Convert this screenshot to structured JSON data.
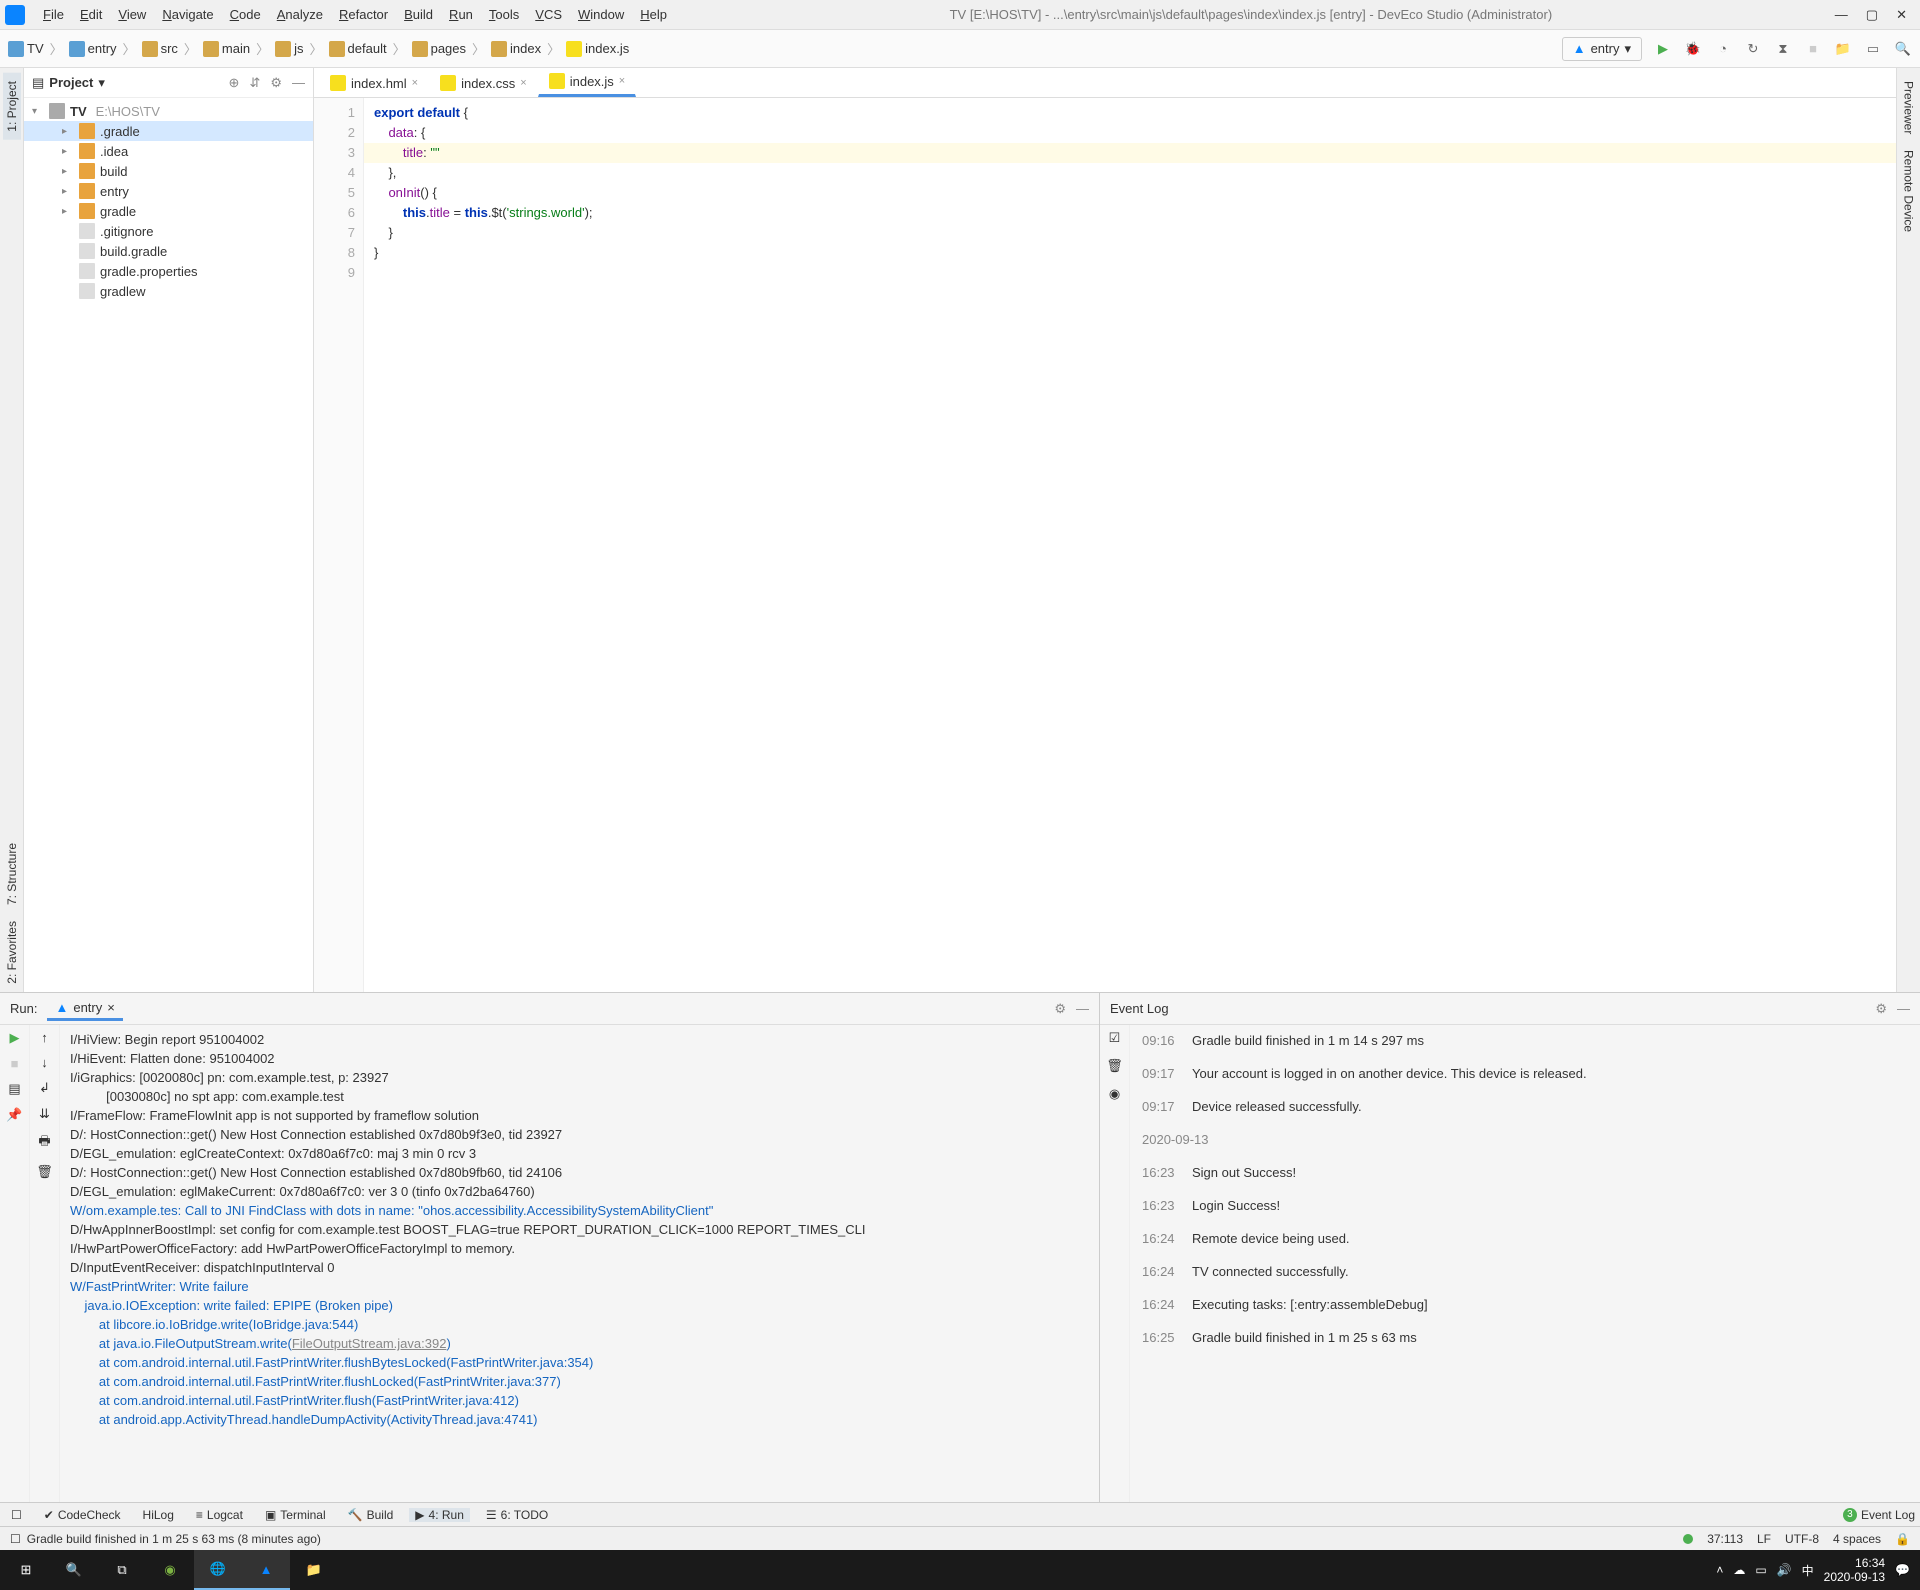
{
  "menubar": {
    "items": [
      "File",
      "Edit",
      "View",
      "Navigate",
      "Code",
      "Analyze",
      "Refactor",
      "Build",
      "Run",
      "Tools",
      "VCS",
      "Window",
      "Help"
    ],
    "title": "TV [E:\\HOS\\TV] - ...\\entry\\src\\main\\js\\default\\pages\\index\\index.js [entry] - DevEco Studio (Administrator)"
  },
  "breadcrumbs": [
    "TV",
    "entry",
    "src",
    "main",
    "js",
    "default",
    "pages",
    "index",
    "index.js"
  ],
  "run_config": "entry",
  "project": {
    "header": "Project",
    "root_label": "TV",
    "root_path": "E:\\HOS\\TV",
    "items": [
      {
        "label": ".gradle",
        "type": "folder",
        "depth": 1,
        "expandable": true,
        "selected": true
      },
      {
        "label": ".idea",
        "type": "folder",
        "depth": 1,
        "expandable": true
      },
      {
        "label": "build",
        "type": "folder",
        "depth": 1,
        "expandable": true
      },
      {
        "label": "entry",
        "type": "folder",
        "depth": 1,
        "expandable": true
      },
      {
        "label": "gradle",
        "type": "folder",
        "depth": 1,
        "expandable": true
      },
      {
        "label": ".gitignore",
        "type": "file",
        "depth": 1
      },
      {
        "label": "build.gradle",
        "type": "file",
        "depth": 1
      },
      {
        "label": "gradle.properties",
        "type": "file",
        "depth": 1
      },
      {
        "label": "gradlew",
        "type": "file",
        "depth": 1
      }
    ]
  },
  "editor": {
    "tabs": [
      {
        "label": "index.hml",
        "active": false
      },
      {
        "label": "index.css",
        "active": false
      },
      {
        "label": "index.js",
        "active": true
      }
    ],
    "code_lines": [
      {
        "n": 1,
        "html": "<span class='kw2'>export default</span> {"
      },
      {
        "n": 2,
        "html": "    <span class='prop2'>data</span>: {"
      },
      {
        "n": 3,
        "html": "        <span class='prop2'>title</span>: <span class='str2'>\"\"</span>",
        "hl": true
      },
      {
        "n": 4,
        "html": "    },"
      },
      {
        "n": 5,
        "html": "    <span class='prop2'>onInit</span>() {"
      },
      {
        "n": 6,
        "html": "        <span class='kw2'>this</span>.<span class='prop2'>title</span> = <span class='kw2'>this</span>.$t(<span class='str2'>'strings.world'</span>);"
      },
      {
        "n": 7,
        "html": "    }"
      },
      {
        "n": 8,
        "html": "}"
      },
      {
        "n": 9,
        "html": ""
      }
    ]
  },
  "run_panel": {
    "title": "Run:",
    "tab": "entry",
    "lines": [
      {
        "t": "I/HiView: Begin report 951004002"
      },
      {
        "t": "I/HiEvent: Flatten done: 951004002"
      },
      {
        "t": "I/iGraphics: [0020080c] pn: com.example.test, p: 23927"
      },
      {
        "t": "          [0030080c] no spt app: com.example.test"
      },
      {
        "t": "I/FrameFlow: FrameFlowInit app is not supported by frameflow solution"
      },
      {
        "t": "D/: HostConnection::get() New Host Connection established 0x7d80b9f3e0, tid 23927"
      },
      {
        "t": "D/EGL_emulation: eglCreateContext: 0x7d80a6f7c0: maj 3 min 0 rcv 3"
      },
      {
        "t": "D/: HostConnection::get() New Host Connection established 0x7d80b9fb60, tid 24106"
      },
      {
        "t": "D/EGL_emulation: eglMakeCurrent: 0x7d80a6f7c0: ver 3 0 (tinfo 0x7d2ba64760)"
      },
      {
        "t": "W/om.example.tes: Call to JNI FindClass with dots in name: \"ohos.accessibility.AccessibilitySystemAbilityClient\"",
        "cls": "warn"
      },
      {
        "t": "D/HwAppInnerBoostImpl: set config for com.example.test BOOST_FLAG=true REPORT_DURATION_CLICK=1000 REPORT_TIMES_CLI"
      },
      {
        "t": "I/HwPartPowerOfficeFactory: add HwPartPowerOfficeFactoryImpl to memory."
      },
      {
        "t": "D/InputEventReceiver: dispatchInputInterval 0"
      },
      {
        "t": "W/FastPrintWriter: Write failure",
        "cls": "warn"
      },
      {
        "t": "    java.io.IOException: write failed: EPIPE (Broken pipe)",
        "cls": "warn"
      },
      {
        "t": "        at libcore.io.IoBridge.write(IoBridge.java:544)",
        "cls": "warn"
      },
      {
        "t": "        at java.io.FileOutputStream.write(",
        "cls": "warn",
        "tail": "FileOutputStream.java:392",
        "tailcls": "link",
        "end": ")"
      },
      {
        "t": "        at com.android.internal.util.FastPrintWriter.flushBytesLocked(FastPrintWriter.java:354)",
        "cls": "warn"
      },
      {
        "t": "        at com.android.internal.util.FastPrintWriter.flushLocked(FastPrintWriter.java:377)",
        "cls": "warn"
      },
      {
        "t": "        at com.android.internal.util.FastPrintWriter.flush(FastPrintWriter.java:412)",
        "cls": "warn"
      },
      {
        "t": "        at android.app.ActivityThread.handleDumpActivity(ActivityThread.java:4741)",
        "cls": "warn"
      }
    ]
  },
  "event_log": {
    "title": "Event Log",
    "entries": [
      {
        "time": "09:16",
        "msg": "Gradle build finished in 1 m 14 s 297 ms"
      },
      {
        "time": "09:17",
        "msg": "Your account is logged in on another device. This device is released."
      },
      {
        "time": "09:17",
        "msg": "Device released successfully."
      },
      {
        "time": "",
        "msg": "2020-09-13"
      },
      {
        "time": "16:23",
        "msg": "Sign out Success!"
      },
      {
        "time": "16:23",
        "msg": "Login Success!"
      },
      {
        "time": "16:24",
        "msg": "Remote device being used."
      },
      {
        "time": "16:24",
        "msg": "TV connected successfully."
      },
      {
        "time": "16:24",
        "msg": "Executing tasks: [:entry:assembleDebug]"
      },
      {
        "time": "16:25",
        "msg": "Gradle build finished in 1 m 25 s 63 ms"
      }
    ]
  },
  "leftbar_tabs": [
    "1: Project",
    "7: Structure",
    "2: Favorites"
  ],
  "rightbar_tabs": [
    "Previewer",
    "Remote Device"
  ],
  "bottom_tabs": {
    "left_check": "",
    "codecheck": "CodeCheck",
    "hilog": "HiLog",
    "logcat": "Logcat",
    "terminal": "Terminal",
    "build": "Build",
    "run": "4: Run",
    "todo": "6: TODO",
    "eventlog": "Event Log",
    "badge": "3"
  },
  "statusbar": {
    "msg": "Gradle build finished in 1 m 25 s 63 ms (8 minutes ago)",
    "pos": "37:113",
    "lf": "LF",
    "enc": "UTF-8",
    "indent": "4 spaces"
  },
  "taskbar": {
    "time": "16:34",
    "date": "2020-09-13"
  }
}
